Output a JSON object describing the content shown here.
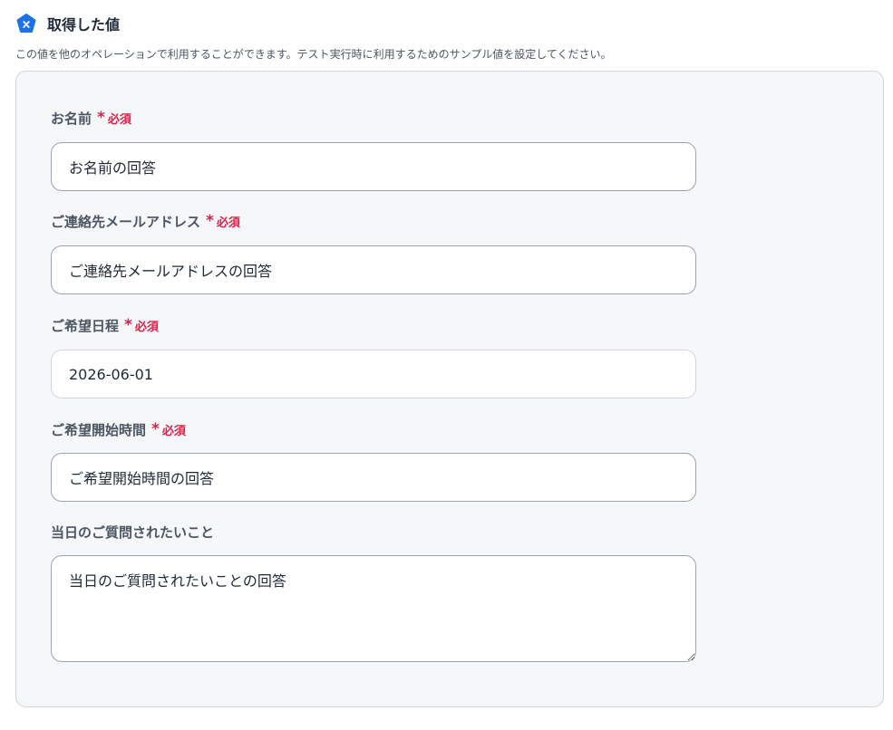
{
  "section": {
    "icon": "x-badge-icon",
    "title": "取得した値",
    "description": "この値を他のオペレーションで利用することができます。テスト実行時に利用するためのサンプル値を設定してください。"
  },
  "required_mark": "*",
  "required_text": "必須",
  "colors": {
    "accent": "#1a73e8",
    "required": "#e11d48",
    "panel_bg": "#f5f7f9"
  },
  "fields": [
    {
      "label": "お名前",
      "value": "お名前の回答",
      "required": true
    },
    {
      "label": "ご連絡先メールアドレス",
      "value": "ご連絡先メールアドレスの回答",
      "required": true
    },
    {
      "label": "ご希望日程",
      "value": "2026-06-01",
      "required": true
    },
    {
      "label": "ご希望開始時間",
      "value": "ご希望開始時間の回答",
      "required": true
    },
    {
      "label": "当日のご質問されたいこと",
      "value": "当日のご質問されたいことの回答",
      "required": false
    }
  ]
}
